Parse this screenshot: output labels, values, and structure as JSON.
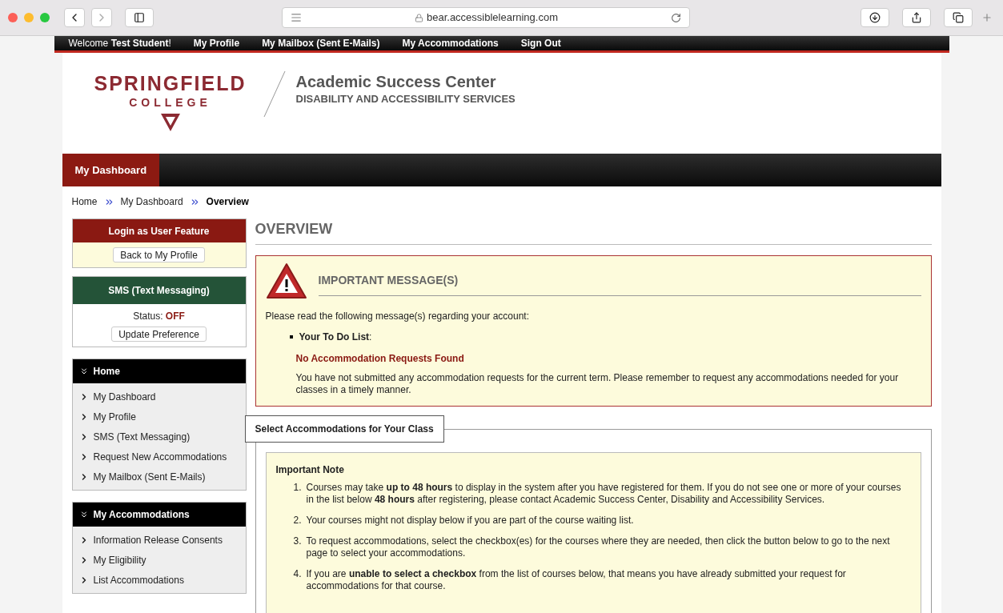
{
  "browser": {
    "url": "bear.accessiblelearning.com"
  },
  "topbar": {
    "welcome": "Welcome",
    "user": "Test Student",
    "welcome_end": "!",
    "links": [
      "My Profile",
      "My Mailbox (Sent E-Mails)",
      "My Accommodations",
      "Sign Out"
    ]
  },
  "header": {
    "logo_top": "SPRINGFIELD",
    "logo_bottom": "COLLEGE",
    "title": "Academic Success Center",
    "subtitle": "DISABILITY AND ACCESSIBILITY SERVICES"
  },
  "nav": {
    "tabs": [
      {
        "label": "My Dashboard",
        "selected": true
      }
    ]
  },
  "breadcrumb": [
    {
      "label": "Home",
      "current": false
    },
    {
      "label": "My Dashboard",
      "current": false
    },
    {
      "label": "Overview",
      "current": true
    }
  ],
  "sidebar": {
    "login_panel": {
      "title": "Login as User Feature",
      "button": "Back to My Profile"
    },
    "sms_panel": {
      "title": "SMS (Text Messaging)",
      "status_label": "Status:",
      "status": "OFF",
      "button": "Update Preference"
    },
    "menus": [
      {
        "title": "Home",
        "items": [
          "My Dashboard",
          "My Profile",
          "SMS (Text Messaging)",
          "Request New Accommodations",
          "My Mailbox (Sent E-Mails)"
        ]
      },
      {
        "title": "My Accommodations",
        "items": [
          "Information Release Consents",
          "My Eligibility",
          "List Accommodations"
        ]
      }
    ]
  },
  "main": {
    "title": "OVERVIEW",
    "message": {
      "title": "IMPORTANT MESSAGE(S)",
      "intro": "Please read the following message(s) regarding your account:",
      "list_label": "Your To Do List",
      "list_colon": ":",
      "alert": "No Accommodation Requests Found",
      "body": "You have not submitted any accommodation requests for the current term. Please remember to request any accommodations needed for your classes in a timely manner."
    },
    "section": {
      "legend": "Select Accommodations for Your Class",
      "note_title": "Important Note",
      "notes": [
        {
          "number": "1.",
          "text": "Courses may take **up to 48 hours** to display in the system after you have registered for them. If you do not see one or more of your courses in the list below **48 hours** after registering, please contact Academic Success Center, Disability and Accessibility Services."
        },
        {
          "number": "2.",
          "text": "Your courses might not display below if you are part of the course waiting list."
        },
        {
          "number": "3.",
          "text": "To request accommodations, select the checkbox(es) for the courses where they are needed, then click the button below to go to the next page to select your accommodations."
        },
        {
          "number": "4.",
          "text": "If you are **unable to select a checkbox** from the list of courses below, that means you have already submitted your request for accommodations for that course."
        }
      ]
    }
  }
}
